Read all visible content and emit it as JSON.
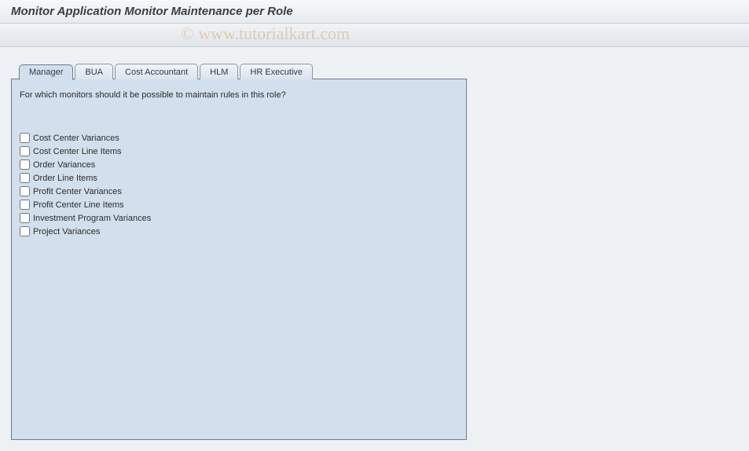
{
  "header": {
    "title": "Monitor Application Monitor Maintenance per Role"
  },
  "watermark": "© www.tutorialkart.com",
  "tabs": [
    {
      "label": "Manager",
      "active": true
    },
    {
      "label": "BUA",
      "active": false
    },
    {
      "label": "Cost Accountant",
      "active": false
    },
    {
      "label": "HLM",
      "active": false
    },
    {
      "label": "HR Executive",
      "active": false
    }
  ],
  "panel": {
    "prompt": "For which monitors should it be possible to maintain rules in this role?",
    "options": [
      {
        "label": "Cost Center Variances",
        "checked": false
      },
      {
        "label": "Cost Center Line Items",
        "checked": false
      },
      {
        "label": "Order Variances",
        "checked": false
      },
      {
        "label": "Order Line Items",
        "checked": false
      },
      {
        "label": "Profit Center Variances",
        "checked": false
      },
      {
        "label": "Profit Center Line Items",
        "checked": false
      },
      {
        "label": "Investment Program Variances",
        "checked": false
      },
      {
        "label": "Project Variances",
        "checked": false
      }
    ]
  }
}
